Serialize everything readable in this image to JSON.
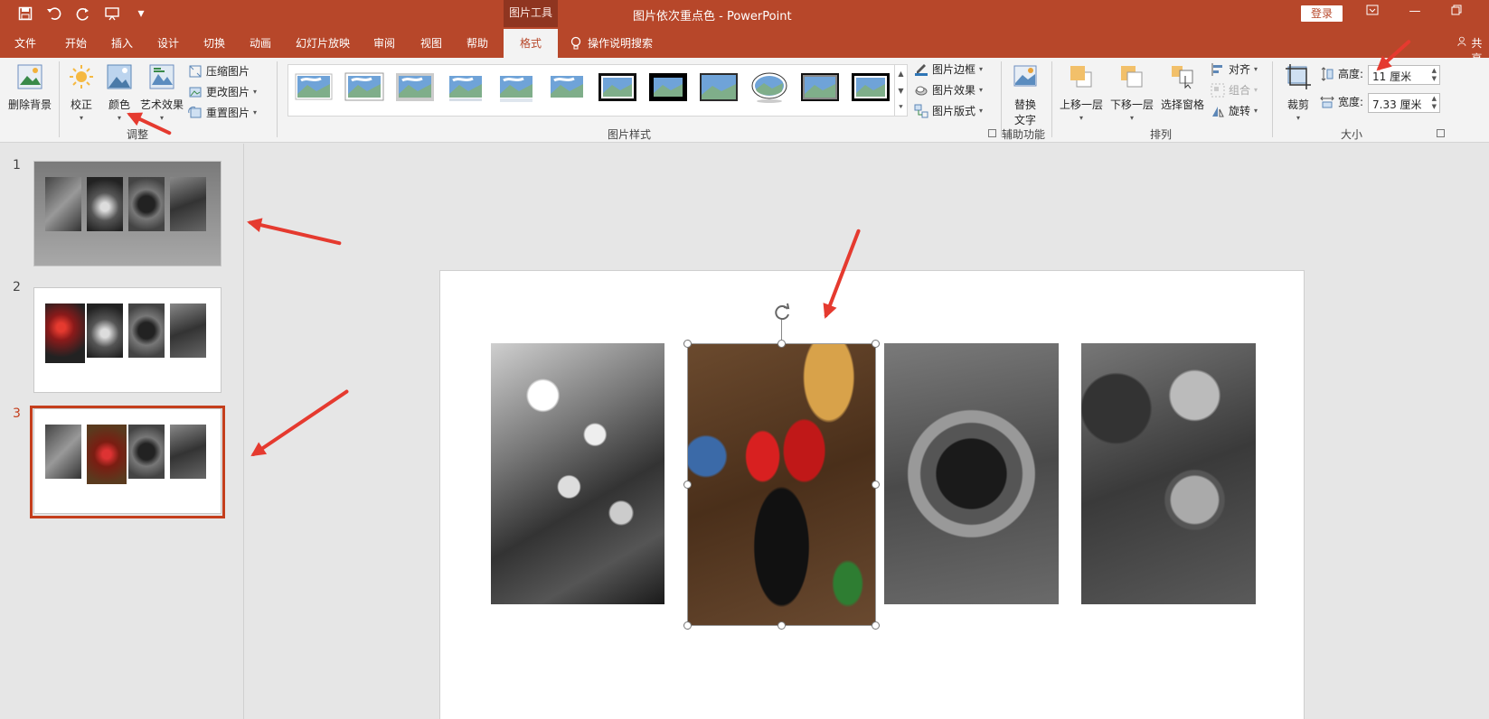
{
  "app": {
    "document_title": "图片依次重点色 - PowerPoint",
    "context_tool_label": "图片工具",
    "login_label": "登录"
  },
  "tabs": [
    {
      "label": "文件"
    },
    {
      "label": "开始"
    },
    {
      "label": "插入"
    },
    {
      "label": "设计"
    },
    {
      "label": "切换"
    },
    {
      "label": "动画"
    },
    {
      "label": "幻灯片放映"
    },
    {
      "label": "审阅"
    },
    {
      "label": "视图"
    },
    {
      "label": "帮助"
    },
    {
      "label": "格式",
      "active": true
    }
  ],
  "tell_me": {
    "label": "操作说明搜索",
    "icon": "lightbulb-icon"
  },
  "share": {
    "label": "共享"
  },
  "ribbon": {
    "adjust": {
      "remove_bg": "删除背景",
      "corrections": "校正",
      "color": "颜色",
      "artistic": "艺术效果",
      "compress": "压缩图片",
      "change": "更改图片",
      "reset": "重置图片",
      "group_name": "调整"
    },
    "styles": {
      "border": "图片边框",
      "effects": "图片效果",
      "layout": "图片版式",
      "group_name": "图片样式"
    },
    "accessibility": {
      "alt_text_line1": "替换",
      "alt_text_line2": "文字",
      "group_name": "辅助功能"
    },
    "arrange": {
      "bring_forward": "上移一层",
      "send_backward": "下移一层",
      "selection_pane": "选择窗格",
      "align": "对齐",
      "group": "组合",
      "rotate": "旋转",
      "group_name": "排列"
    },
    "size": {
      "crop": "裁剪",
      "height_label": "高度:",
      "height_value": "11 厘米",
      "width_label": "宽度:",
      "width_value": "7.33 厘米",
      "group_name": "大小"
    }
  },
  "slides": [
    {
      "number": "1"
    },
    {
      "number": "2"
    },
    {
      "number": "3",
      "selected": true
    }
  ],
  "colors": {
    "accent": "#b7472a",
    "annotation_arrow": "#e53a2f",
    "selection": "#c43e1c"
  }
}
